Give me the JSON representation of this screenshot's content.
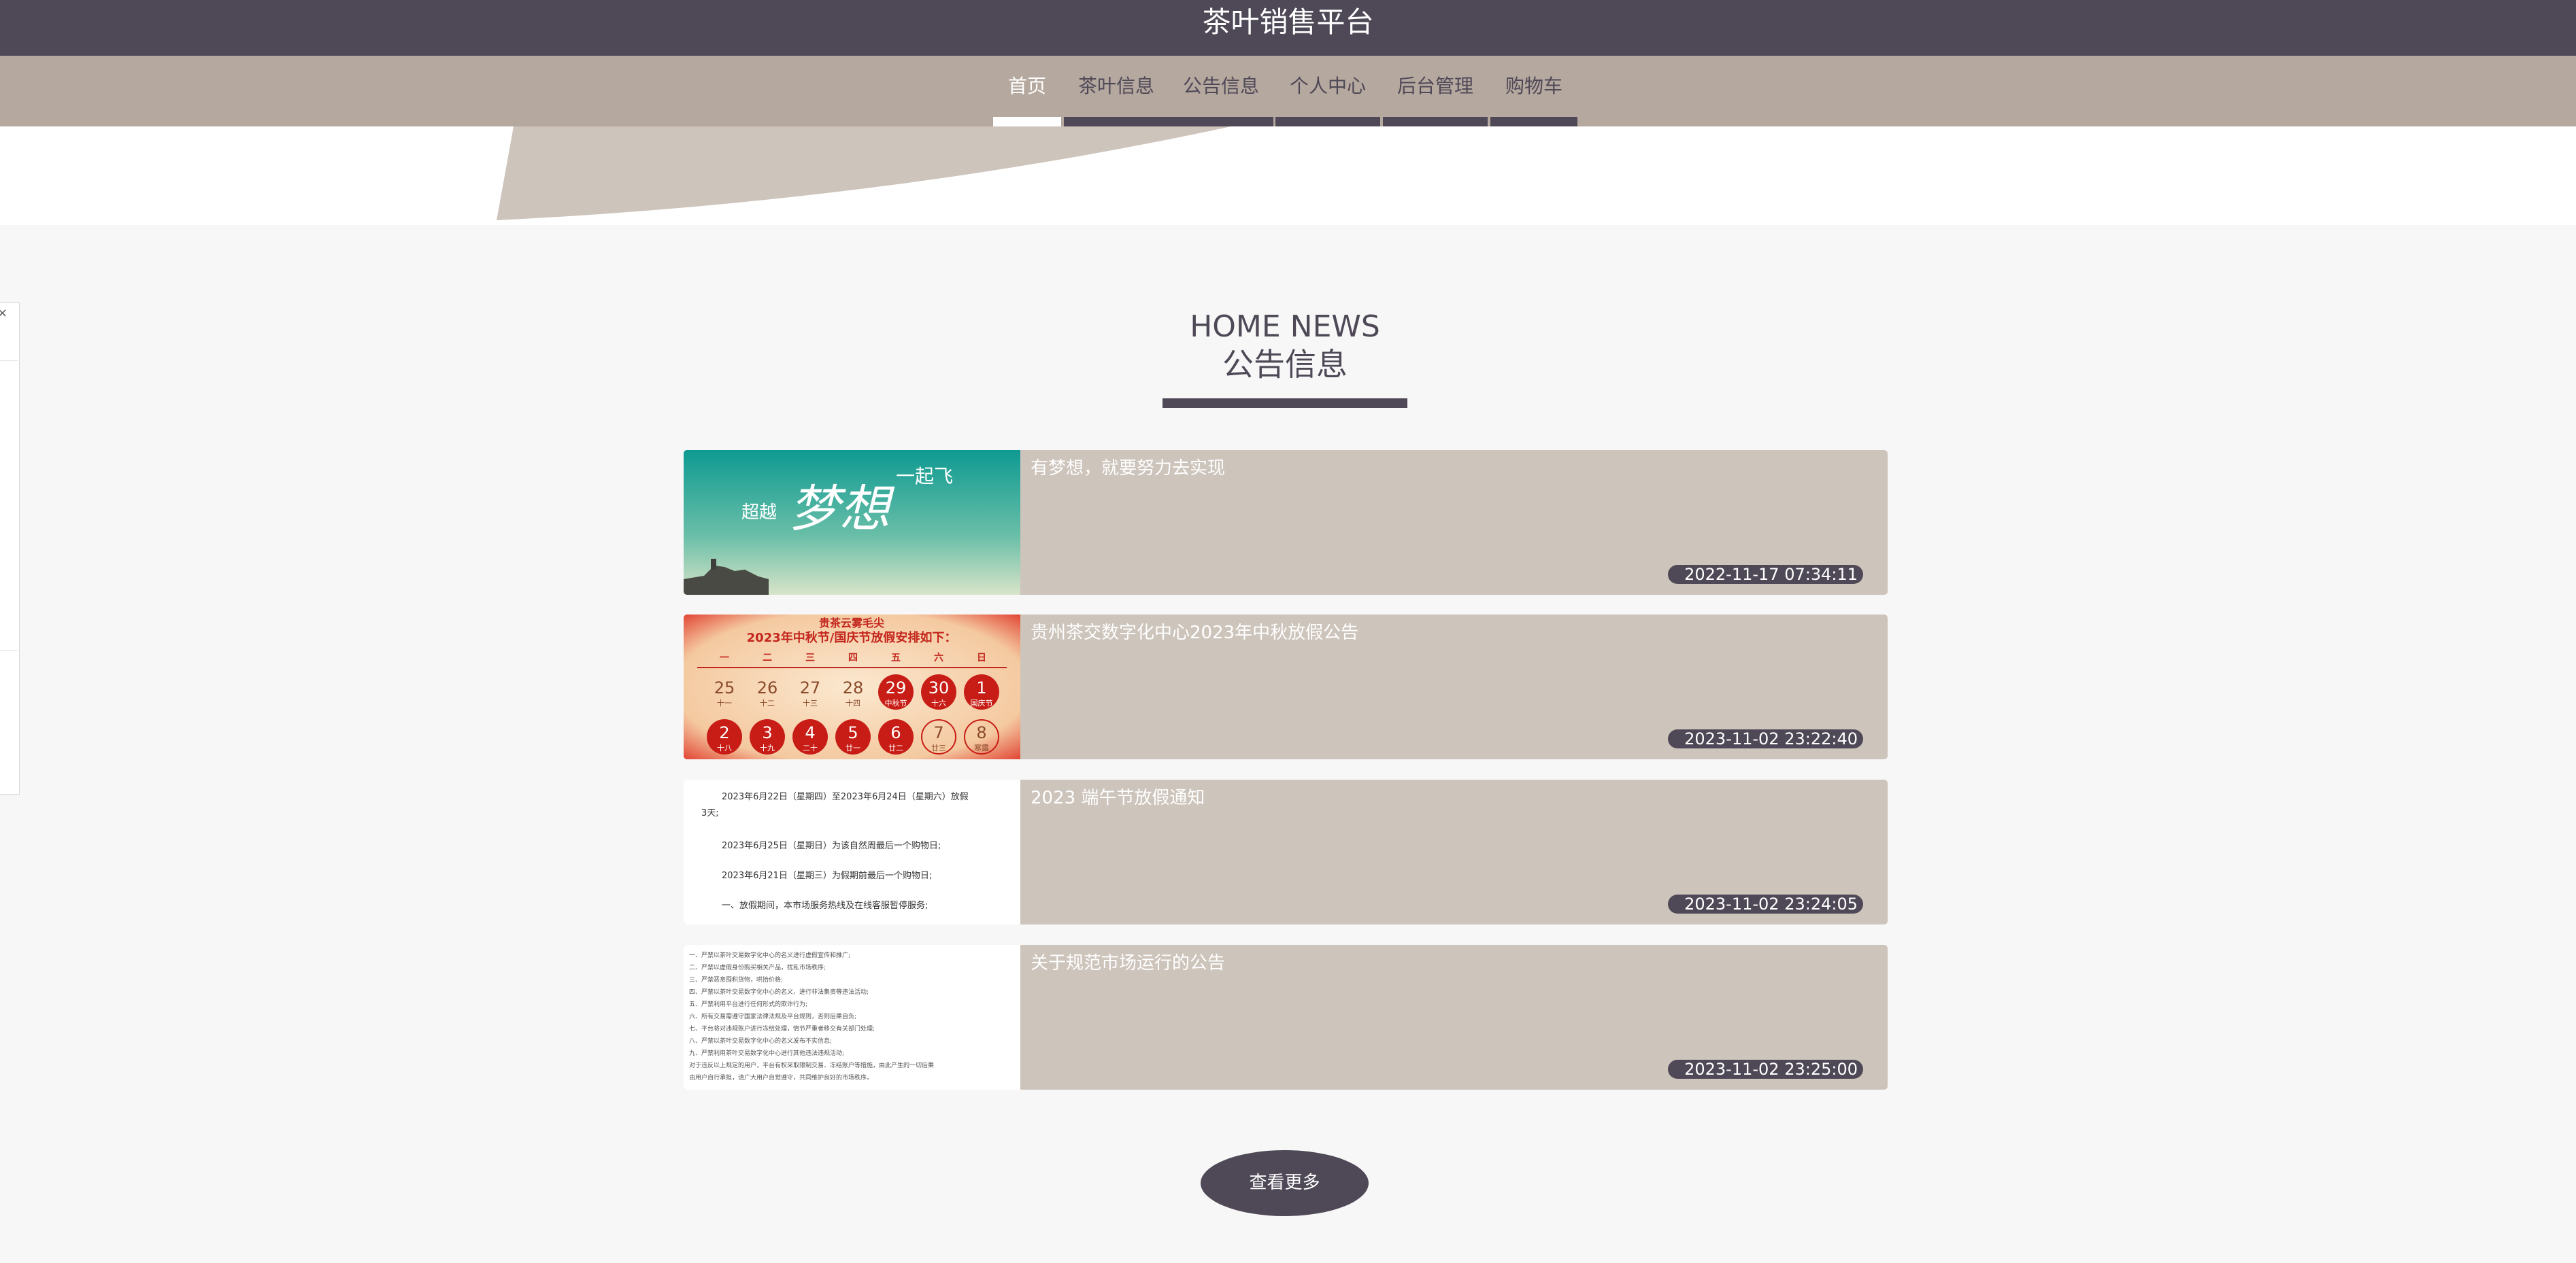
{
  "site": {
    "title": "茶叶销售平台"
  },
  "nav": [
    {
      "label": "首页"
    },
    {
      "label": "茶叶信息"
    },
    {
      "label": "公告信息"
    },
    {
      "label": "个人中心"
    },
    {
      "label": "后台管理"
    },
    {
      "label": "购物车"
    }
  ],
  "float_panel": {
    "close": "×"
  },
  "section": {
    "title_en": "HOME NEWS",
    "title_cn": "公告信息"
  },
  "news": [
    {
      "title": "有梦想，就要努力去实现",
      "time": "2022-11-17 07:34:11",
      "img": {
        "w1": "超越",
        "w2": "梦想",
        "w3": "一起飞"
      }
    },
    {
      "title": "贵州茶交数字化中心2023年中秋放假公告",
      "time": "2023-11-02 23:22:40",
      "img": {
        "head1": "贵茶云雾毛尖",
        "head2": "2023年中秋节/国庆节放假安排如下：",
        "weekdays": [
          "一",
          "二",
          "三",
          "四",
          "五",
          "六",
          "日"
        ],
        "row1": [
          {
            "d": "25",
            "s": "十一",
            "hl": false
          },
          {
            "d": "26",
            "s": "十二",
            "hl": false
          },
          {
            "d": "27",
            "s": "十三",
            "hl": false
          },
          {
            "d": "28",
            "s": "十四",
            "hl": false
          },
          {
            "d": "29",
            "s": "中秋节",
            "hl": true
          },
          {
            "d": "30",
            "s": "十六",
            "hl": true
          },
          {
            "d": "1",
            "s": "国庆节",
            "hl": true
          }
        ],
        "row2": [
          {
            "d": "2",
            "s": "十八",
            "hl": true
          },
          {
            "d": "3",
            "s": "十九",
            "hl": true
          },
          {
            "d": "4",
            "s": "二十",
            "hl": true
          },
          {
            "d": "5",
            "s": "廿一",
            "hl": true
          },
          {
            "d": "6",
            "s": "廿二",
            "hl": true
          },
          {
            "d": "7",
            "s": "廿三",
            "hl": false
          },
          {
            "d": "8",
            "s": "寒露",
            "hl": false
          }
        ]
      }
    },
    {
      "title": "2023 端午节放假通知",
      "time": "2023-11-02 23:24:05",
      "img": {
        "lines": [
          "2023年6月22日（星期四）至2023年6月24日（星期六）放假",
          "3天;",
          "2023年6月25日（星期日）为该自然周最后一个购物日;",
          "2023年6月21日（星期三）为假期前最后一个购物日;",
          "一、放假期间，本市场服务热线及在线客服暂停服务;"
        ]
      }
    },
    {
      "title": "关于规范市场运行的公告",
      "time": "2023-11-02 23:25:00",
      "img": {
        "lines": [
          "一、严禁以茶叶交易数字化中心的名义进行虚假宣传和推广;",
          "二、严禁以虚假身份购买相关产品，扰乱市场秩序;",
          "三、严禁恶意囤积货物，哄抬价格;",
          "四、严禁以茶叶交易数字化中心的名义，进行非法集资等违法活动;",
          "五、严禁利用平台进行任何形式的欺诈行为;",
          "六、所有交易需遵守国家法律法规及平台规则，否则后果自负;",
          "七、平台将对违规账户进行冻结处理，情节严重者移交有关部门处理;",
          "八、严禁以茶叶交易数字化中心的名义发布不实信息;",
          "九、严禁利用茶叶交易数字化中心进行其他违法违规活动;",
          "对于违反以上规定的用户，平台有权采取限制交易、冻结账户等措施，由此产生的一切后果",
          "由用户自行承担，请广大用户自觉遵守，共同维护良好的市场秩序。"
        ]
      }
    }
  ],
  "more_button": "查看更多",
  "colors": {
    "primary": "#4f4957",
    "nav_bg": "#b5a89f",
    "card_bg": "#cdc4bb"
  }
}
